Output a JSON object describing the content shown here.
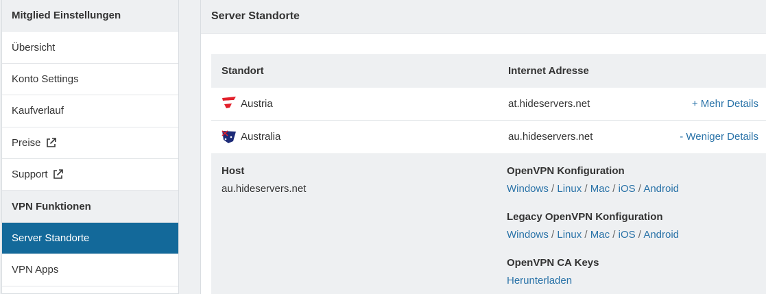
{
  "sidebar": {
    "section1_title": "Mitglied Einstellungen",
    "items1": [
      {
        "label": "Übersicht"
      },
      {
        "label": "Konto Settings"
      },
      {
        "label": "Kaufverlauf"
      },
      {
        "label": "Preise"
      },
      {
        "label": "Support"
      }
    ],
    "section2_title": "VPN Funktionen",
    "items2": [
      {
        "label": "Server Standorte",
        "active": true
      },
      {
        "label": "VPN Apps"
      }
    ]
  },
  "main": {
    "title": "Server Standorte",
    "table": {
      "headers": [
        "Standort",
        "Internet Adresse"
      ],
      "rows": [
        {
          "location": "Austria",
          "address": "at.hideservers.net",
          "action": "+ Mehr Details"
        },
        {
          "location": "Australia",
          "address": "au.hideservers.net",
          "action": "- Weniger Details"
        }
      ]
    },
    "details": {
      "host_label": "Host",
      "host_value": "au.hideservers.net",
      "openvpn_label": "OpenVPN Konfiguration",
      "openvpn_links": [
        "Windows",
        "Linux",
        "Mac",
        "iOS",
        "Android"
      ],
      "legacy_label": "Legacy OpenVPN Konfiguration",
      "legacy_links": [
        "Windows",
        "Linux",
        "Mac",
        "iOS",
        "Android"
      ],
      "ca_label": "OpenVPN CA Keys",
      "ca_link": "Herunterladen"
    }
  },
  "colors": {
    "accent": "#13699a",
    "link": "#2a73a8"
  },
  "icons": [
    "external-link-icon",
    "austria-flag-icon",
    "australia-flag-icon"
  ]
}
